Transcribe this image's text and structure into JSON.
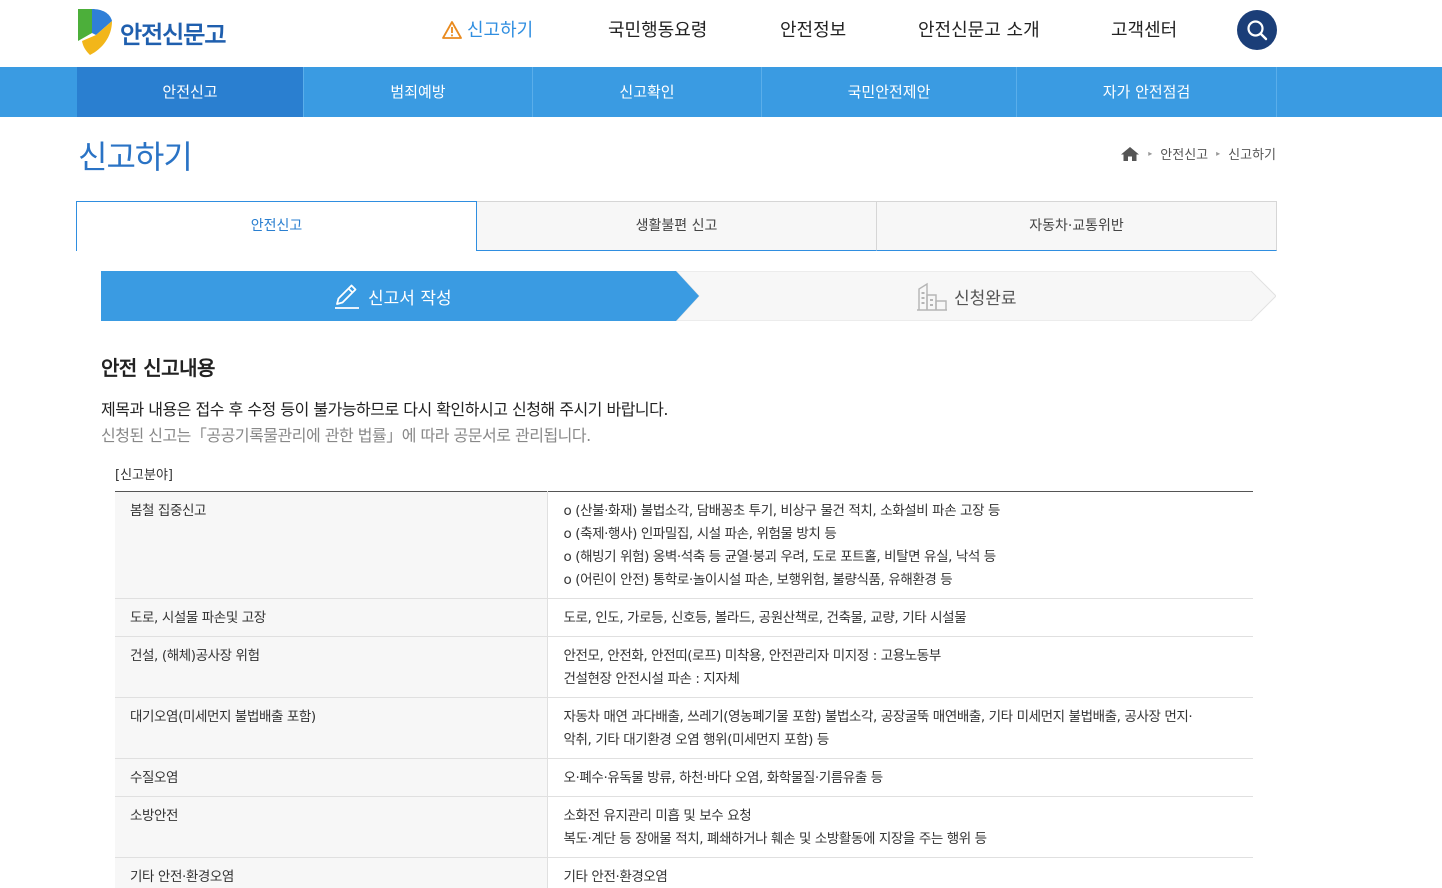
{
  "header": {
    "logo_text": "안전신문고",
    "nav": [
      {
        "label": "신고하기",
        "active": true
      },
      {
        "label": "국민행동요령"
      },
      {
        "label": "안전정보"
      },
      {
        "label": "안전신문고 소개"
      },
      {
        "label": "고객센터"
      }
    ],
    "search_icon": "search-icon"
  },
  "subnav": [
    {
      "label": "안전신고",
      "active": true
    },
    {
      "label": "범죄예방"
    },
    {
      "label": "신고확인"
    },
    {
      "label": "국민안전제안"
    },
    {
      "label": "자가 안전점검"
    }
  ],
  "page": {
    "title": "신고하기",
    "breadcrumb": [
      "안전신고",
      "신고하기"
    ]
  },
  "tabs": [
    {
      "label": "안전신고",
      "active": true
    },
    {
      "label": "생활불편 신고"
    },
    {
      "label": "자동차·교통위반"
    }
  ],
  "steps": [
    {
      "label": "신고서 작성",
      "active": true,
      "icon": "pencil-icon"
    },
    {
      "label": "신청완료",
      "active": false,
      "icon": "building-icon"
    }
  ],
  "section": {
    "title": "안전 신고내용",
    "notice_main": "제목과 내용은 접수 후 수정 등이 불가능하므로 다시 확인하시고 신청해 주시기 바랍니다.",
    "notice_sub": "신청된 신고는「공공기록물관리에 관한 법률」에 따라 공문서로 관리됩니다.",
    "table_caption": "[신고분야]"
  },
  "categories": [
    {
      "name": "봄철 집중신고",
      "desc": [
        "o (산불·화재) 불법소각, 담배꽁초 투기, 비상구 물건 적치, 소화설비 파손 고장 등",
        "o (축제·행사) 인파밀집, 시설 파손, 위험물 방치 등",
        "o (해빙기 위험) 옹벽·석축 등 균열·붕괴 우려, 도로 포트홀, 비탈면 유실, 낙석 등",
        "o (어린이 안전) 통학로·놀이시설 파손, 보행위험, 불량식품, 유해환경 등"
      ]
    },
    {
      "name": "도로, 시설물 파손및 고장",
      "desc": [
        "도로, 인도, 가로등, 신호등, 볼라드, 공원산책로, 건축물, 교량, 기타 시설물"
      ]
    },
    {
      "name": "건설, (해체)공사장 위험",
      "desc": [
        "안전모, 안전화, 안전띠(로프) 미착용, 안전관리자 미지정 : 고용노동부",
        "건설현장 안전시설 파손 : 지자체"
      ]
    },
    {
      "name": "대기오염(미세먼지 불법배출 포함)",
      "desc": [
        "자동차 매연 과다배출, 쓰레기(영농폐기물 포함) 불법소각, 공장굴뚝 매연배출, 기타 미세먼지 불법배출, 공사장 먼지·",
        "악취, 기타 대기환경 오염 행위(미세먼지 포함) 등"
      ]
    },
    {
      "name": "수질오염",
      "desc": [
        "오·폐수·유독물 방류, 하천·바다 오염, 화학물질·기름유출 등"
      ]
    },
    {
      "name": "소방안전",
      "desc": [
        "소화전 유지관리 미흡 및 보수 요청",
        "복도·계단 등 장애물 적치, 폐쇄하거나 훼손 및 소방활동에 지장을 주는 행위 등"
      ]
    },
    {
      "name": "기타 안전·환경오염",
      "desc": [
        "기타 안전·환경오염"
      ]
    }
  ],
  "colors": {
    "accent": "#2f8ee0",
    "navy": "#1b3e78",
    "subnav_bg": "#3a9be2",
    "subnav_active": "#2a7fd0",
    "title_blue": "#2a73c5"
  }
}
